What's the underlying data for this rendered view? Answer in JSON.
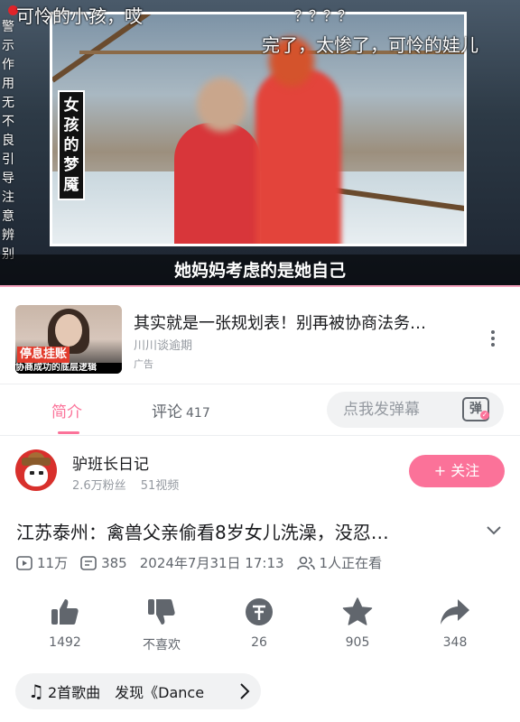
{
  "player": {
    "danmaku": [
      "可怜的小孩，哎",
      "？？？？",
      "完了，太惨了，可怜的娃儿"
    ],
    "side_notice": "警示作用无不良引导注意辨别",
    "overlay_label": "女孩的梦魇",
    "subtitle": "她妈妈考虑的是她自己",
    "progress_fraction": 1.0
  },
  "ad": {
    "thumb_text_1": "停息挂账",
    "thumb_text_2": "协商成功的底层逻辑",
    "title": "其实就是一张规划表！别再被协商法务…",
    "source": "川川谈逾期",
    "badge": "广告",
    "more_icon": "more-vertical-icon"
  },
  "tabs": {
    "intro": "简介",
    "comments": "评论",
    "comments_count": "417",
    "danmaku_placeholder": "点我发弹幕",
    "danmaku_button": "弹"
  },
  "uploader": {
    "name": "驴班长日记",
    "fans": "2.6万粉丝",
    "videos": "51视频",
    "follow_label": "+ 关注"
  },
  "video": {
    "title": "江苏泰州：禽兽父亲偷看8岁女儿洗澡，没忍…",
    "views": "11万",
    "danmaku_count": "385",
    "date": "2024年7月31日 17:13",
    "watching": "1人正在看"
  },
  "actions": [
    {
      "icon": "thumbs-up-icon",
      "label": "1492"
    },
    {
      "icon": "thumbs-down-icon",
      "label": "不喜欢"
    },
    {
      "icon": "coin-icon",
      "label": "26"
    },
    {
      "icon": "star-icon",
      "label": "905"
    },
    {
      "icon": "share-icon",
      "label": "348"
    }
  ],
  "music": {
    "text1": "2首歌曲",
    "text2": "发现《Dance"
  },
  "colors": {
    "accent": "#fb7299",
    "text": "#18191c",
    "muted": "#9499a0"
  }
}
